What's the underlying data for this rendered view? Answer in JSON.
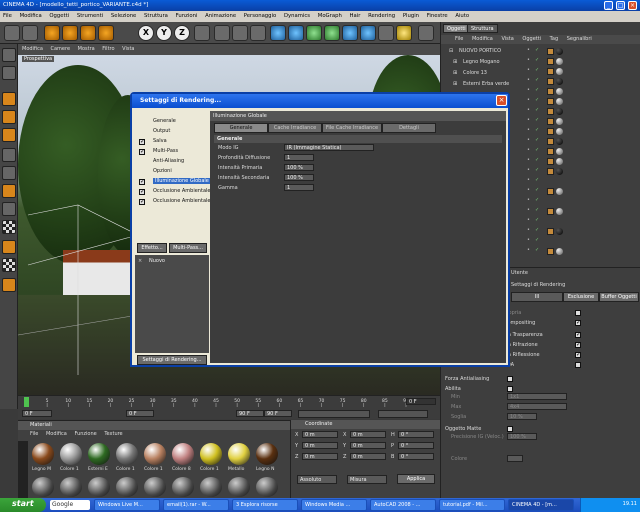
{
  "window": {
    "title": "CINEMA 4D - [modello_tetti_portico_VARIANTE.c4d *]"
  },
  "menubar": {
    "items": [
      "File",
      "Modifica",
      "Oggetti",
      "Strumenti",
      "Selezione",
      "Struttura",
      "Funzioni",
      "Animazione",
      "Personaggio",
      "Dynamics",
      "MoGraph",
      "Hair",
      "Rendering",
      "Plugin",
      "Finestre",
      "Aiuto"
    ]
  },
  "viewport": {
    "menu": [
      "Modifica",
      "Camere",
      "Mostra",
      "Filtro",
      "Vista"
    ],
    "label": "Prospettiva"
  },
  "objects_panel": {
    "tabs": [
      "Oggetti",
      "Struttura"
    ],
    "menu": [
      "File",
      "Modifica",
      "Vista",
      "Oggetti",
      "Tag",
      "Segnalibri"
    ],
    "rows": [
      "NUOVO PORTICO",
      "Legno Mogano",
      "Colore 13",
      "Esterni Erba verde"
    ]
  },
  "attributes_panel": {
    "title_fragment": "Utente",
    "field_fragment": "Settaggi di Rendering",
    "buttons": [
      "Ill",
      "Esclusione",
      "Buffer Oggetti"
    ],
    "options": [
      {
        "label": "Ombra Propria",
        "checked": false
      },
      {
        "label": "Sfondo Compositing",
        "checked": true
      },
      {
        "label": "Visto dalla Trasparenza",
        "checked": true
      },
      {
        "label": "Visto dalla Rifrazione",
        "checked": true
      },
      {
        "label": "Visto dalla Riflessione",
        "checked": true
      },
      {
        "label": "Visto da OA",
        "checked": false
      },
      {
        "label": "Forza Antialiasing",
        "checked": false
      },
      {
        "label": "Abilita",
        "checked": false
      },
      {
        "label": "Oggetto Matte",
        "checked": false
      }
    ],
    "min_label": "Min",
    "min_value": "1x1",
    "max_label": "Max",
    "max_value": "4x4",
    "soglia_label": "Soglia",
    "soglia_value": "10 %",
    "precision_label": "Precisione IG (Veloc.)",
    "precision_value": "100 %",
    "colore_label": "Colore"
  },
  "dialog": {
    "title": "Settaggi di Rendering...",
    "nav": [
      "Generale",
      "Output",
      "Salva",
      "Multi-Pass",
      "Anti-Aliasing",
      "Opzioni",
      "Illuminazione Globale",
      "Occlusione Ambientale",
      "Occlusione Ambientale"
    ],
    "nav_checked": [
      false,
      false,
      true,
      true,
      false,
      false,
      true,
      true,
      true
    ],
    "effect_button": "Effetto...",
    "multipass_button": "Multi-Pass...",
    "new_item": "Nuovo",
    "footer_button": "Settaggi di Rendering...",
    "section_title": "Illuminazione Globale",
    "tabs": [
      "Generale",
      "Cache Irradiance",
      "File Cache Irradiance",
      "Dettagli"
    ],
    "group_title": "Generale",
    "fields": [
      {
        "label": "Modo IG",
        "value": "IR (Immagine Statica)"
      },
      {
        "label": "Profondità Diffusione",
        "value": "1"
      },
      {
        "label": "Intensità Primaria",
        "value": "100 %"
      },
      {
        "label": "Intensità Secondaria",
        "value": "100 %"
      },
      {
        "label": "Gamma",
        "value": "1"
      }
    ]
  },
  "timeline": {
    "ticks": [
      "0",
      "5",
      "10",
      "15",
      "20",
      "25",
      "30",
      "35",
      "40",
      "45",
      "50",
      "55",
      "60",
      "65",
      "70",
      "75",
      "80",
      "85",
      "90"
    ],
    "start": "0 F",
    "current": "0 F",
    "end": "90 F",
    "end2": "90 F",
    "frame_counter": "0 F"
  },
  "materials": {
    "title": "Materiali",
    "menu": [
      "File",
      "Modifica",
      "Funzione",
      "Texture"
    ],
    "items": [
      {
        "name": "Legno M",
        "color": "#8a4a1c"
      },
      {
        "name": "Colore 1",
        "color": "#9a9a9a"
      },
      {
        "name": "Esterni E",
        "color": "#2e6a22"
      },
      {
        "name": "Colore 1",
        "color": "#777777"
      },
      {
        "name": "Colore 1",
        "color": "#b88060"
      },
      {
        "name": "Colore 8",
        "color": "#c08080"
      },
      {
        "name": "Colore 1",
        "color": "#d0c020"
      },
      {
        "name": "Metallo",
        "color": "#e0d040"
      },
      {
        "name": "Legno N",
        "color": "#5a3010"
      }
    ]
  },
  "coordinates": {
    "title": "Coordinate",
    "rows": [
      {
        "a": "X",
        "av": "0 m",
        "b": "X",
        "bv": "0 m",
        "c": "H",
        "cv": "0 °"
      },
      {
        "a": "Y",
        "av": "0 m",
        "b": "Y",
        "bv": "0 m",
        "c": "P",
        "cv": "0 °"
      },
      {
        "a": "Z",
        "av": "0 m",
        "b": "Z",
        "bv": "0 m",
        "c": "B",
        "cv": "0 °"
      }
    ],
    "mode1": "Assoluto",
    "mode2": "Misura",
    "apply": "Applica"
  },
  "taskbar": {
    "start": "start",
    "search": "Google",
    "items": [
      {
        "label": "Windows Live M...",
        "active": false
      },
      {
        "label": "email(1).rar - W...",
        "active": false
      },
      {
        "label": "3 Esplora risorse",
        "active": false
      },
      {
        "label": "Windows Media ...",
        "active": false
      },
      {
        "label": "AutoCAD 2008 - ...",
        "active": false
      },
      {
        "label": "tutorial.pdf - Mil...",
        "active": false
      },
      {
        "label": "CINEMA 4D - [m...",
        "active": true
      }
    ],
    "clock": "19.11"
  },
  "colors": {
    "accent": "#0a4ed0",
    "panel": "#3e3e3e",
    "orange": "#d8861b"
  },
  "icons": [
    "undo-icon",
    "redo-icon",
    "move-icon",
    "scale-icon",
    "rotate-icon",
    "x-axis-icon",
    "y-axis-icon",
    "z-axis-icon",
    "render-icon",
    "cube-icon",
    "light-icon",
    "camera-icon",
    "search-icon"
  ]
}
